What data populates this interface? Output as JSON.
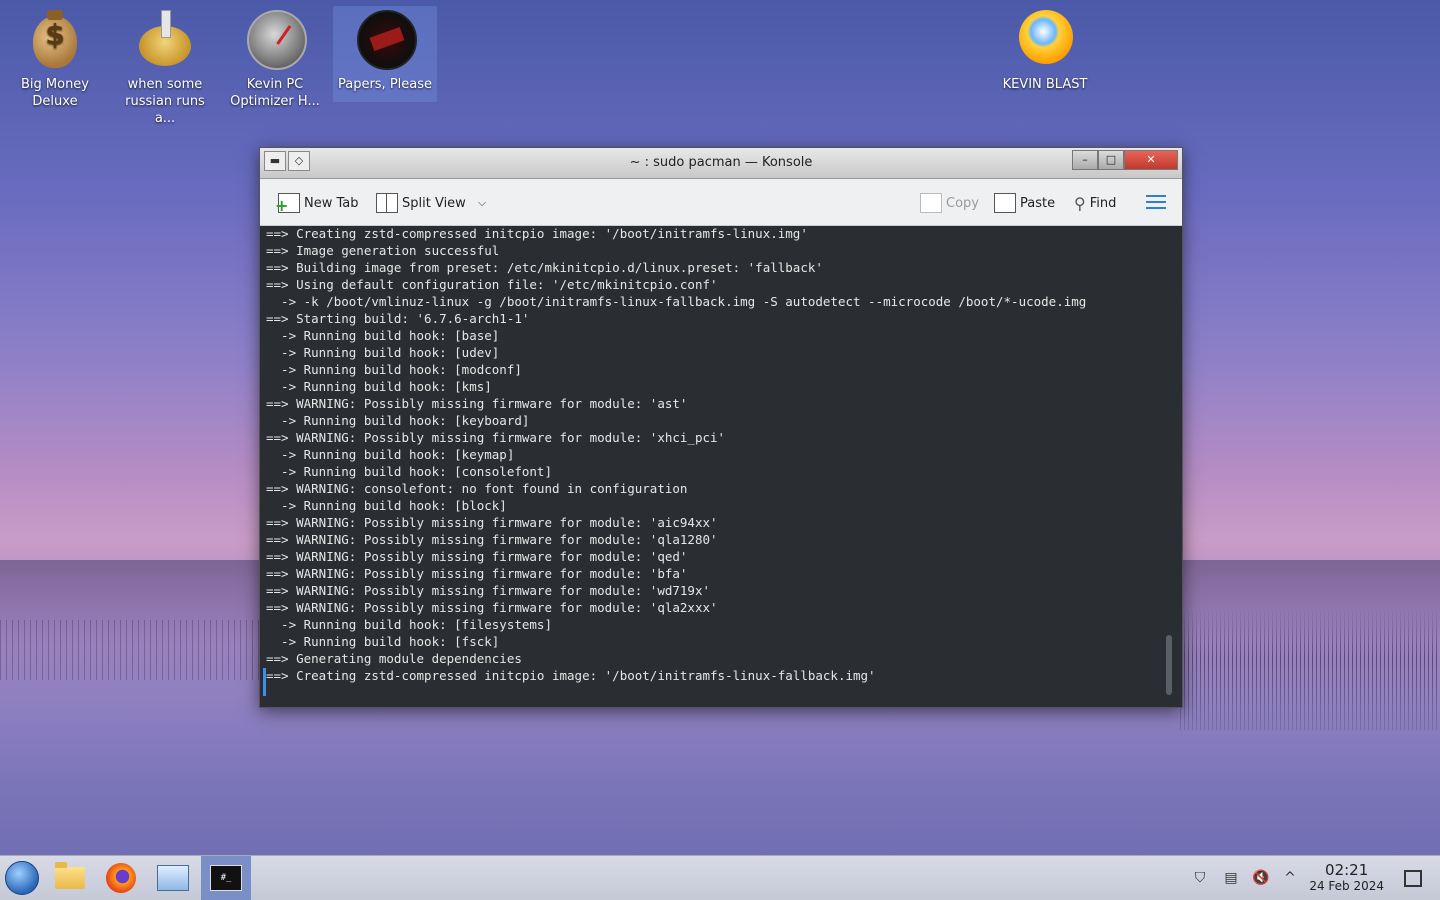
{
  "desktop": {
    "icons": [
      {
        "label": "Big Money\nDeluxe"
      },
      {
        "label": "when some\nrussian runs a..."
      },
      {
        "label": "Kevin PC\nOptimizer H..."
      },
      {
        "label": "Papers, Please"
      },
      {
        "label": "KEVIN BLAST"
      }
    ]
  },
  "window": {
    "title": "~ : sudo pacman — Konsole",
    "toolbar": {
      "new_tab": "New Tab",
      "split_view": "Split View",
      "copy": "Copy",
      "paste": "Paste",
      "find": "Find"
    },
    "terminal_lines": [
      "==> Creating zstd-compressed initcpio image: '/boot/initramfs-linux.img'",
      "==> Image generation successful",
      "==> Building image from preset: /etc/mkinitcpio.d/linux.preset: 'fallback'",
      "==> Using default configuration file: '/etc/mkinitcpio.conf'",
      "  -> -k /boot/vmlinuz-linux -g /boot/initramfs-linux-fallback.img -S autodetect --microcode /boot/*-ucode.img",
      "==> Starting build: '6.7.6-arch1-1'",
      "  -> Running build hook: [base]",
      "  -> Running build hook: [udev]",
      "  -> Running build hook: [modconf]",
      "  -> Running build hook: [kms]",
      "==> WARNING: Possibly missing firmware for module: 'ast'",
      "  -> Running build hook: [keyboard]",
      "==> WARNING: Possibly missing firmware for module: 'xhci_pci'",
      "  -> Running build hook: [keymap]",
      "  -> Running build hook: [consolefont]",
      "==> WARNING: consolefont: no font found in configuration",
      "  -> Running build hook: [block]",
      "==> WARNING: Possibly missing firmware for module: 'aic94xx'",
      "==> WARNING: Possibly missing firmware for module: 'qla1280'",
      "==> WARNING: Possibly missing firmware for module: 'qed'",
      "==> WARNING: Possibly missing firmware for module: 'bfa'",
      "==> WARNING: Possibly missing firmware for module: 'wd719x'",
      "==> WARNING: Possibly missing firmware for module: 'qla2xxx'",
      "  -> Running build hook: [filesystems]",
      "  -> Running build hook: [fsck]",
      "==> Generating module dependencies",
      "==> Creating zstd-compressed initcpio image: '/boot/initramfs-linux-fallback.img'"
    ]
  },
  "taskbar": {
    "clock_time": "02:21",
    "clock_date": "24 Feb 2024"
  },
  "icons": {
    "start": "start-menu-icon",
    "files": "folder-icon",
    "browser": "firefox-icon",
    "monitor": "system-monitor-icon",
    "terminal": "konsole-icon",
    "volume": "volume-muted-icon"
  }
}
